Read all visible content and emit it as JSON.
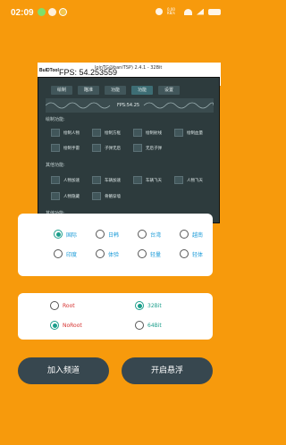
{
  "status_bar": {
    "time": "02:09",
    "speed": "0.00 KB/s"
  },
  "overlay": {
    "logo": "BulDTool",
    "package": "loinTG@baniTSP) 2.4.1 - 32Bit",
    "fps_text": "FPS: 54.253559",
    "tabs": [
      "绘制",
      "瞄准",
      "功能",
      "功能",
      "设置"
    ],
    "active_tab": 3,
    "fps_strip_value": "FPS:54.25",
    "sections": [
      {
        "title": "绘制功能:",
        "options": [
          "绘制人物",
          "绘制方框",
          "绘制射线",
          "绘制血量",
          "绘制手雷",
          "子弹无后",
          "无后子弹"
        ]
      },
      {
        "title": "其他功能:",
        "options": [
          "人物加速",
          "车辆加速",
          "车辆飞天",
          "人物飞天",
          "人物隐藏",
          "骨骼穿墙"
        ]
      },
      {
        "title": "其他功能:",
        "options": []
      }
    ]
  },
  "region_card": {
    "row1": [
      "国际",
      "日韩",
      "台湾",
      "越南"
    ],
    "row2": [
      "印度",
      "体验",
      "轻量",
      "轻体"
    ],
    "selected": "国际"
  },
  "root_card": {
    "root_label": "Root",
    "noroot_label": "NoRoot",
    "bit32_label": "32Bit",
    "bit64_label": "64Bit",
    "selected_root": "NoRoot",
    "selected_bit": "32Bit"
  },
  "buttons": {
    "join": "加入频道",
    "float": "开启悬浮"
  }
}
